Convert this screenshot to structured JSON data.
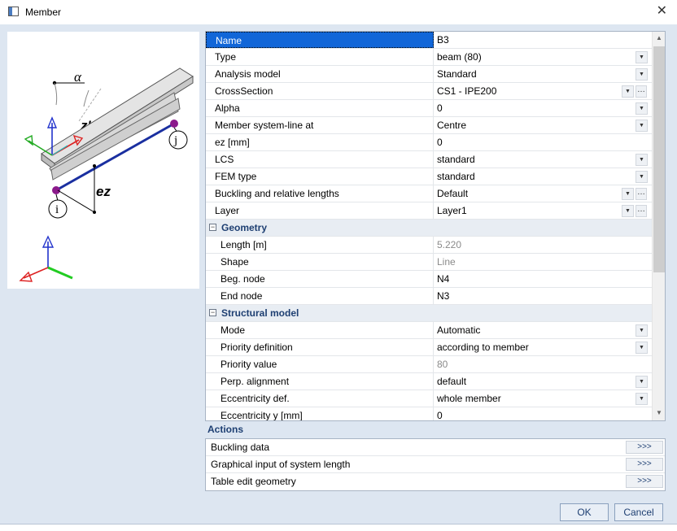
{
  "window": {
    "title": "Member",
    "close_glyph": "✕"
  },
  "preview": {
    "labels": {
      "alpha": "α",
      "z_prime": "z'",
      "end_j": "j",
      "end_i": "i",
      "ez": "ez"
    }
  },
  "grid": {
    "rows": [
      {
        "name": "Name",
        "value": "B3",
        "selected": true
      },
      {
        "name": "Type",
        "value": "beam (80)",
        "dropdown": true
      },
      {
        "name": "Analysis model",
        "value": "Standard",
        "dropdown": true
      },
      {
        "name": "CrossSection",
        "value": "CS1 - IPE200",
        "dropdown": true,
        "ellipsis": true
      },
      {
        "name": "Alpha",
        "value": "0",
        "dropdown": true
      },
      {
        "name": "Member system-line at",
        "value": "Centre",
        "dropdown": true
      },
      {
        "name": "ez [mm]",
        "value": "0"
      },
      {
        "name": "LCS",
        "value": "standard",
        "dropdown": true
      },
      {
        "name": "FEM type",
        "value": "standard",
        "dropdown": true
      },
      {
        "name": "Buckling and relative lengths",
        "value": "Default",
        "dropdown": true,
        "ellipsis": true
      },
      {
        "name": "Layer",
        "value": "Layer1",
        "dropdown": true,
        "ellipsis": true
      }
    ],
    "geometry": {
      "title": "Geometry",
      "rows": [
        {
          "name": "Length [m]",
          "value": "5.220",
          "readonly": true
        },
        {
          "name": "Shape",
          "value": "Line",
          "readonly": true
        },
        {
          "name": "Beg. node",
          "value": "N4"
        },
        {
          "name": "End node",
          "value": "N3"
        }
      ]
    },
    "structural": {
      "title": "Structural model",
      "rows": [
        {
          "name": "Mode",
          "value": "Automatic",
          "dropdown": true
        },
        {
          "name": "Priority definition",
          "value": "according to member",
          "dropdown": true
        },
        {
          "name": "Priority value",
          "value": "80",
          "readonly": true
        },
        {
          "name": "Perp. alignment",
          "value": "default",
          "dropdown": true
        },
        {
          "name": "Eccentricity def.",
          "value": "whole member",
          "dropdown": true
        },
        {
          "name": "Eccentricity y [mm]",
          "value": "0"
        }
      ]
    }
  },
  "actions": {
    "title": "Actions",
    "items": [
      {
        "label": "Buckling data",
        "button": ">>>"
      },
      {
        "label": "Graphical input of system length",
        "button": ">>>"
      },
      {
        "label": "Table edit geometry",
        "button": ">>>"
      }
    ]
  },
  "footer": {
    "ok": "OK",
    "cancel": "Cancel"
  },
  "colors": {
    "selection": "#1166d8",
    "group_title": "#1e3f72",
    "panel_bg": "#dde6f1",
    "member_line": "#1a2fa0",
    "node": "#8b1a8b"
  }
}
